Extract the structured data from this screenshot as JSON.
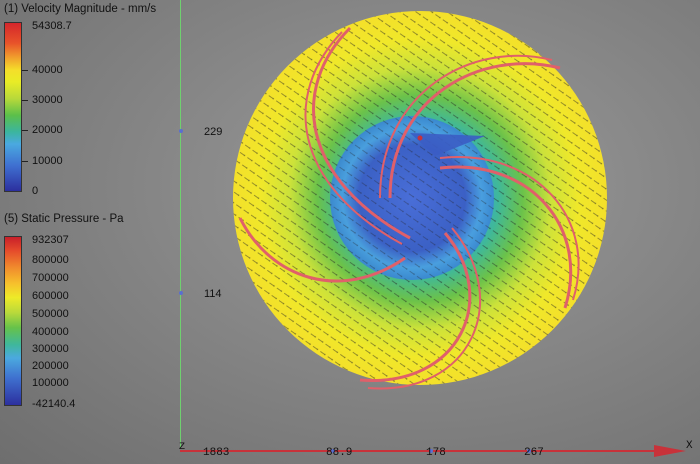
{
  "legend_velocity": {
    "title": "(1) Velocity Magnitude - mm/s",
    "max": "54308.7",
    "ticks": [
      "40000",
      "30000",
      "20000",
      "10000",
      "0"
    ]
  },
  "legend_pressure": {
    "title": "(5) Static Pressure - Pa",
    "max": "932307",
    "ticks": [
      "800000",
      "700000",
      "600000",
      "500000",
      "400000",
      "300000",
      "200000",
      "100000"
    ],
    "min": "-42140.4"
  },
  "y_axis": {
    "ticks": [
      "229",
      "114"
    ]
  },
  "x_axis": {
    "origin_label": "Z",
    "origin_value": "1883",
    "ticks": [
      "88.9",
      "178",
      "267"
    ],
    "axis_label": "X"
  },
  "colors": {
    "impeller_blade": "#e0606a",
    "hub": "#3f6fd0",
    "axis_x": "#c8323a",
    "axis_y": "#6fd06f"
  }
}
